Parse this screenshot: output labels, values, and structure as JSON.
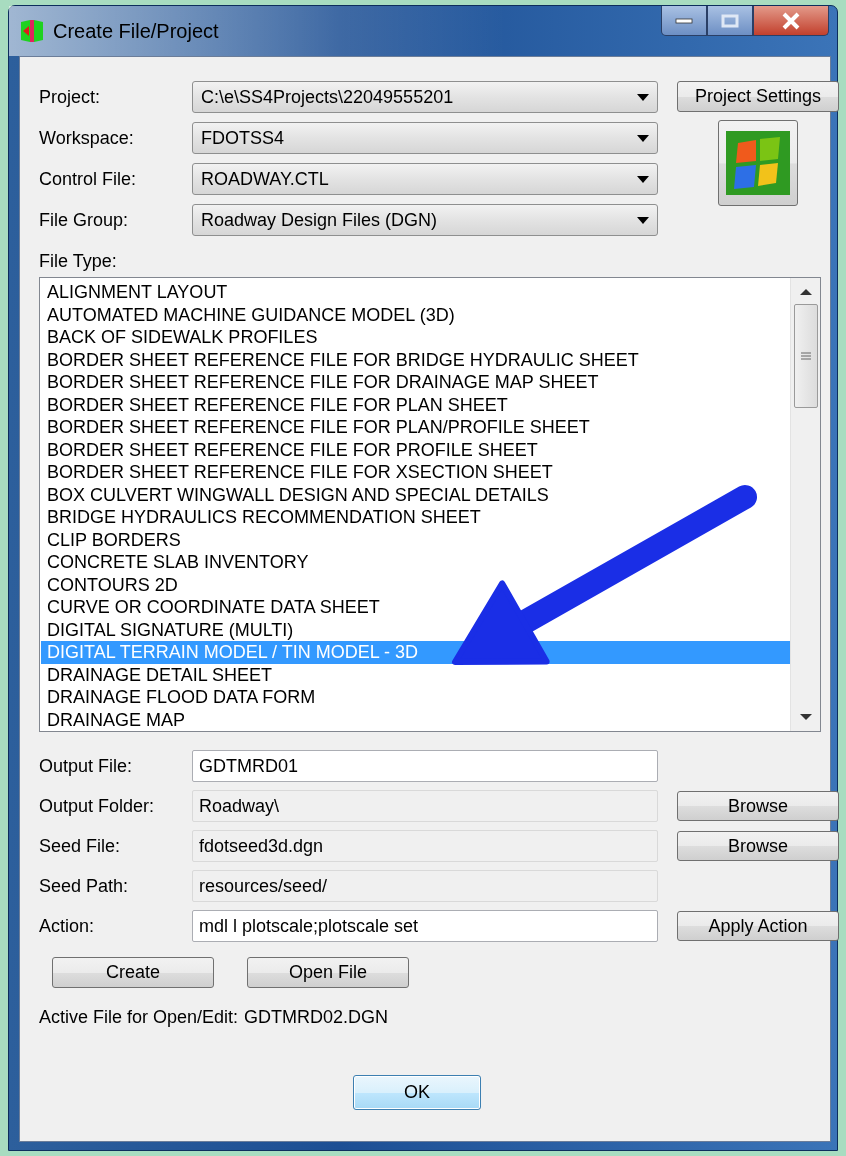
{
  "window": {
    "title": "Create File/Project"
  },
  "selectors": [
    {
      "label": "Project:",
      "value": "C:\\e\\SS4Projects\\22049555201"
    },
    {
      "label": "Workspace:",
      "value": "FDOTSS4"
    },
    {
      "label": "Control File:",
      "value": "ROADWAY.CTL"
    },
    {
      "label": "File Group:",
      "value": "Roadway Design Files (DGN)"
    }
  ],
  "project_settings_button": "Project Settings",
  "file_type": {
    "label": "File Type:",
    "items": [
      {
        "text": "ALIGNMENT LAYOUT",
        "selected": false
      },
      {
        "text": "AUTOMATED MACHINE GUIDANCE MODEL (3D)",
        "selected": false
      },
      {
        "text": "BACK OF SIDEWALK PROFILES",
        "selected": false
      },
      {
        "text": "BORDER SHEET REFERENCE FILE FOR BRIDGE HYDRAULIC SHEET",
        "selected": false
      },
      {
        "text": "BORDER SHEET REFERENCE FILE FOR DRAINAGE MAP SHEET",
        "selected": false
      },
      {
        "text": "BORDER SHEET REFERENCE FILE FOR PLAN SHEET",
        "selected": false
      },
      {
        "text": "BORDER SHEET REFERENCE FILE FOR PLAN/PROFILE SHEET",
        "selected": false
      },
      {
        "text": "BORDER SHEET REFERENCE FILE FOR PROFILE SHEET",
        "selected": false
      },
      {
        "text": "BORDER SHEET REFERENCE FILE FOR XSECTION SHEET",
        "selected": false
      },
      {
        "text": "BOX CULVERT WINGWALL DESIGN AND SPECIAL DETAILS",
        "selected": false
      },
      {
        "text": "BRIDGE HYDRAULICS RECOMMENDATION SHEET",
        "selected": false
      },
      {
        "text": "CLIP BORDERS",
        "selected": false
      },
      {
        "text": "CONCRETE SLAB INVENTORY",
        "selected": false
      },
      {
        "text": "CONTOURS 2D",
        "selected": false
      },
      {
        "text": "CURVE OR COORDINATE DATA SHEET",
        "selected": false
      },
      {
        "text": "DIGITAL SIGNATURE (MULTI)",
        "selected": false
      },
      {
        "text": "DIGITAL TERRAIN MODEL / TIN MODEL - 3D",
        "selected": true
      },
      {
        "text": "DRAINAGE DETAIL SHEET",
        "selected": false
      },
      {
        "text": "DRAINAGE FLOOD DATA FORM",
        "selected": false
      },
      {
        "text": "DRAINAGE MAP",
        "selected": false
      }
    ]
  },
  "fields": [
    {
      "label": "Output File:",
      "value": "GDTMRD01",
      "disabled": false
    },
    {
      "label": "Output Folder:",
      "value": "Roadway\\",
      "disabled": true,
      "button": "Browse"
    },
    {
      "label": "Seed File:",
      "value": "fdotseed3d.dgn",
      "disabled": true,
      "button": "Browse"
    },
    {
      "label": "Seed Path:",
      "value": "resources/seed/",
      "disabled": true
    },
    {
      "label": "Action:",
      "value": "mdl l plotscale;plotscale set",
      "disabled": false,
      "button": "Apply Action"
    }
  ],
  "action_buttons": [
    "Create",
    "Open File"
  ],
  "active_file": {
    "label": "Active File for Open/Edit:",
    "value": "GDTMRD02.DGN"
  },
  "ok_button": "OK"
}
